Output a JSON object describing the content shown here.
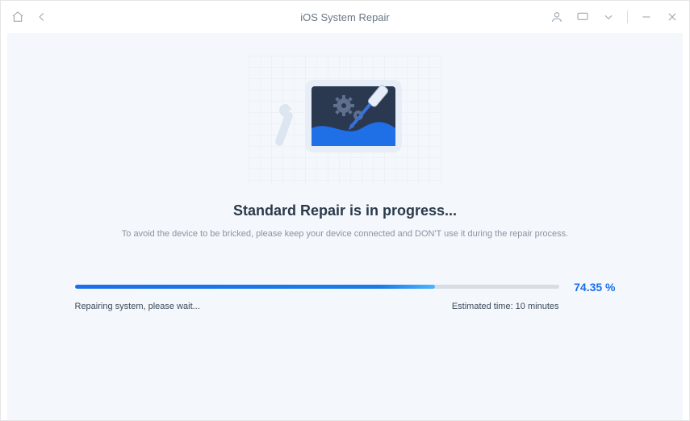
{
  "titlebar": {
    "title": "iOS System Repair"
  },
  "main": {
    "heading": "Standard Repair is in progress...",
    "subtext": "To avoid the device to be bricked, please keep your device connected and DON'T use it during the repair process."
  },
  "progress": {
    "percent_label": "74.35 %",
    "percent_value": 74.35,
    "status_text": "Repairing system, please wait...",
    "eta_text": "Estimated time: 10 minutes"
  }
}
